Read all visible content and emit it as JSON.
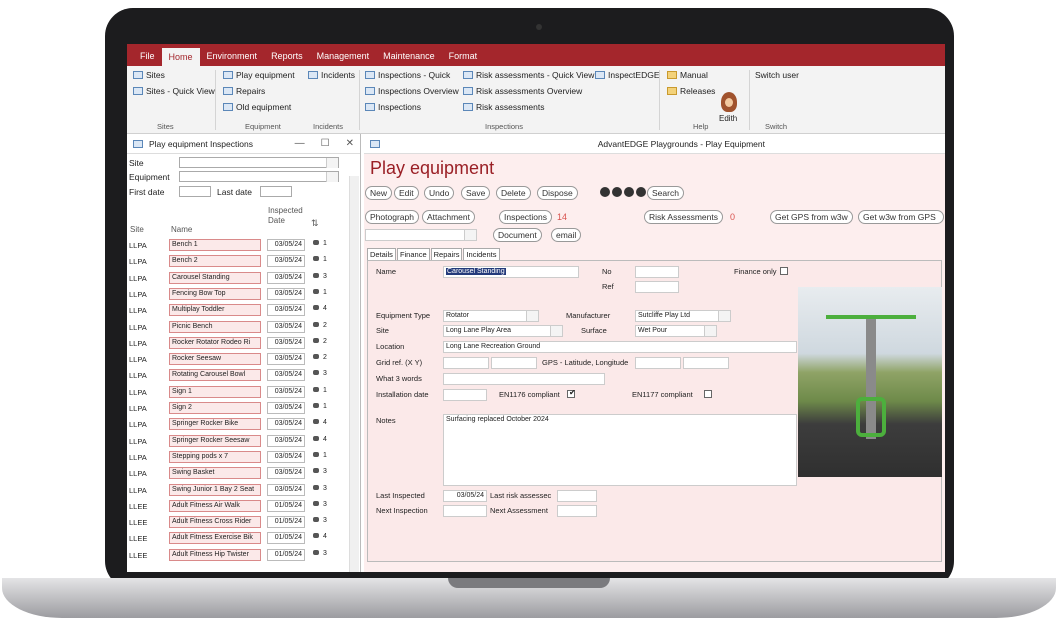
{
  "menu": [
    "File",
    "Home",
    "Environment",
    "Reports",
    "Management",
    "Maintenance",
    "Format"
  ],
  "ribbon": {
    "sites": "Sites",
    "sites_qv": "Sites - Quick View",
    "play_equipment": "Play equipment",
    "repairs": "Repairs",
    "old_equipment": "Old equipment",
    "incidents": "Incidents",
    "insp_quick": "Inspections - Quick",
    "insp_overview": "Inspections Overview",
    "inspections": "Inspections",
    "risk_qv": "Risk assessments - Quick View",
    "risk_overview": "Risk assessments Overview",
    "risk": "Risk assessments",
    "inspectedge": "InspectEDGE",
    "manual": "Manual",
    "releases": "Releases",
    "edith": "Edith",
    "switch_user": "Switch user",
    "groups": {
      "sites": "Sites",
      "equipment": "Equipment",
      "incidents": "Incidents",
      "inspections": "Inspections",
      "help": "Help",
      "switch": "Switch"
    }
  },
  "left": {
    "title": "Play equipment Inspections",
    "win": [
      "—",
      "☐",
      "✕"
    ],
    "site_label": "Site",
    "equipment_label": "Equipment",
    "first_date_label": "First date",
    "last_date_label": "Last date",
    "col_site": "Site",
    "col_name": "Name",
    "col_date": "Inspected Date",
    "rows": [
      [
        "LLPA",
        "Bench 1",
        "03/05/24",
        "1"
      ],
      [
        "LLPA",
        "Bench 2",
        "03/05/24",
        "1"
      ],
      [
        "LLPA",
        "Carousel Standing",
        "03/05/24",
        "3"
      ],
      [
        "LLPA",
        "Fencing Bow Top",
        "03/05/24",
        "1"
      ],
      [
        "LLPA",
        "Multiplay Toddler",
        "03/05/24",
        "4"
      ],
      [
        "LLPA",
        "Picnic Bench",
        "03/05/24",
        "2"
      ],
      [
        "LLPA",
        "Rocker Rotator Rodeo Ri",
        "03/05/24",
        "2"
      ],
      [
        "LLPA",
        "Rocker Seesaw",
        "03/05/24",
        "2"
      ],
      [
        "LLPA",
        "Rotating Carousel Bowl",
        "03/05/24",
        "3"
      ],
      [
        "LLPA",
        "Sign 1",
        "03/05/24",
        "1"
      ],
      [
        "LLPA",
        "Sign 2",
        "03/05/24",
        "1"
      ],
      [
        "LLPA",
        "Springer Rocker Bike",
        "03/05/24",
        "4"
      ],
      [
        "LLPA",
        "Springer Rocker Seesaw",
        "03/05/24",
        "4"
      ],
      [
        "LLPA",
        "Stepping pods x 7",
        "03/05/24",
        "1"
      ],
      [
        "LLPA",
        "Swing Basket",
        "03/05/24",
        "3"
      ],
      [
        "LLPA",
        "Swing Junior 1 Bay 2 Seat",
        "03/05/24",
        "3"
      ],
      [
        "LLEE",
        "Adult Fitness Air Walk",
        "01/05/24",
        "3"
      ],
      [
        "LLEE",
        "Adult Fitness Cross Rider",
        "01/05/24",
        "3"
      ],
      [
        "LLEE",
        "Adult Fitness Exercise Bik",
        "01/05/24",
        "4"
      ],
      [
        "LLEE",
        "Adult Fitness Hip Twister",
        "01/05/24",
        "3"
      ]
    ]
  },
  "main": {
    "window_title": "AdvantEDGE Playgrounds - Play Equipment",
    "page_title": "Play equipment",
    "buttons": {
      "new": "New",
      "edit": "Edit",
      "undo": "Undo",
      "save": "Save",
      "delete": "Delete",
      "dispose": "Dispose",
      "search": "Search",
      "photograph": "Photograph",
      "attachment": "Attachment",
      "inspections": "Inspections",
      "inspections_count": "14",
      "risk": "Risk Assessments",
      "risk_count": "0",
      "gps_from": "Get GPS from w3w",
      "w3w_from": "Get w3w from GPS",
      "document": "Document",
      "email": "email"
    },
    "tabs": [
      "Details",
      "Finance",
      "Repairs",
      "Incidents"
    ],
    "fields": {
      "name_label": "Name",
      "name": "Carousel Standing",
      "no_label": "No",
      "ref_label": "Ref",
      "finance_only": "Finance only",
      "type_label": "Equipment Type",
      "type": "Rotator",
      "manufacturer_label": "Manufacturer",
      "manufacturer": "Sutcliffe Play Ltd",
      "site_label": "Site",
      "site": "Long Lane Play Area",
      "surface_label": "Surface",
      "surface": "Wet Pour",
      "location_label": "Location",
      "location": "Long Lane Recreation Ground",
      "grid_label": "Grid ref. (X Y)",
      "gps_label": "GPS - Latitude, Longitude",
      "w3w_label": "What 3 words",
      "install_label": "Installation date",
      "en1176": "EN1176 compliant",
      "en1177": "EN1177 compliant",
      "notes_label": "Notes",
      "notes": "Surfacing replaced October 2024",
      "last_insp_label": "Last Inspected",
      "last_insp": "03/05/24",
      "last_risk_label": "Last risk assessec",
      "next_insp_label": "Next Inspection",
      "next_assess_label": "Next Assessment"
    }
  }
}
